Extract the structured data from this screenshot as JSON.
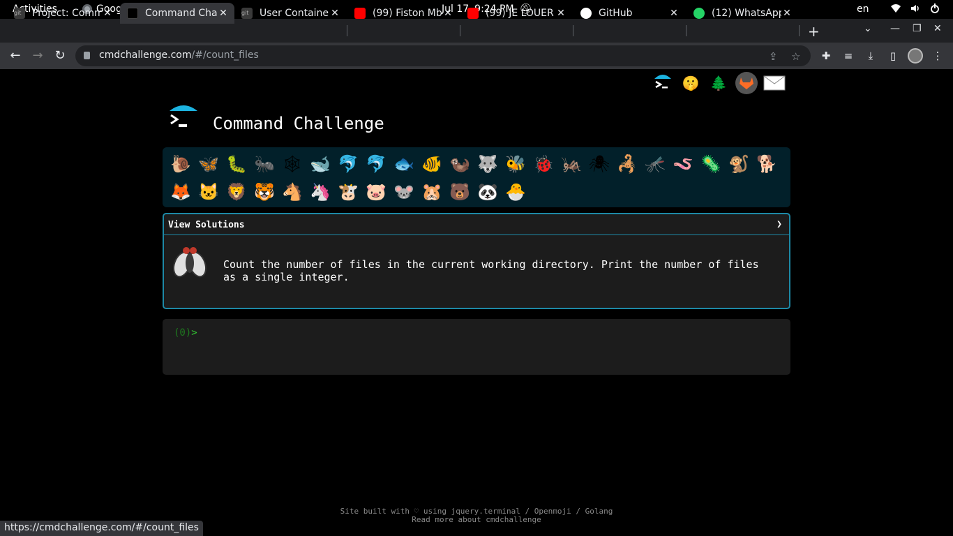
{
  "system_bar": {
    "activities": "Activities",
    "app_name": "Google Chrome",
    "date": "Jul 17",
    "time": "9:24 PM",
    "language": "en"
  },
  "tabs": [
    {
      "title": "Project: Comm",
      "active": false
    },
    {
      "title": "Command Cha",
      "active": true
    },
    {
      "title": "User Containe",
      "active": false
    },
    {
      "title": "(99) Fiston Mb",
      "active": false
    },
    {
      "title": "(99) JE LOUER",
      "active": false
    },
    {
      "title": "GitHub",
      "active": false
    },
    {
      "title": "(12) WhatsApp",
      "active": false
    }
  ],
  "address_bar": {
    "host": "cmdchallenge.com",
    "path": "/#/count_files"
  },
  "page": {
    "title": "Command Challenge",
    "view_solutions": "View Solutions",
    "chevron": "❯",
    "description": "Count the number of files in the current working directory. Print the number of files as a single integer.",
    "prompt_count": "(0)",
    "prompt_symbol": ">",
    "footer_line1": "Site built with ♡ using jquery.terminal / Openmoji / Golang",
    "footer_line2": "Read more about cmdchallenge"
  },
  "animals": [
    "🐌",
    "🦋",
    "🐛",
    "🐜",
    "🕸",
    "🐋",
    "🐬",
    "🐬",
    "🐟",
    "🐠",
    "🦦",
    "🐺",
    "🐝",
    "🐞",
    "🦗",
    "🕷",
    "🦂",
    "🦟",
    "🪱",
    "🦠",
    "🐒",
    "🐕",
    "🦊",
    "🐱",
    "🦁",
    "🐯",
    "🐴",
    "🦄",
    "🐮",
    "🐷",
    "🐭",
    "🐹",
    "🐻",
    "🐼",
    "🐣"
  ],
  "status_url": "https://cmdchallenge.com/#/count_files",
  "colors": {
    "accent": "#1d89a6",
    "prompt_green": "#32c832"
  }
}
